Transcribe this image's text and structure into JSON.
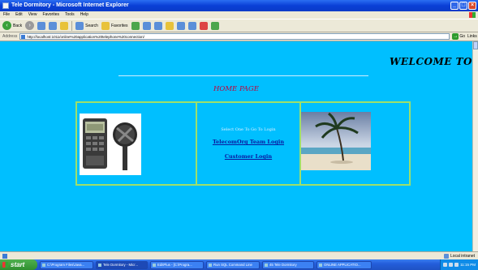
{
  "window": {
    "title": "Tele Dormitory - Microsoft Internet Explorer",
    "buttons": {
      "minimize": "_",
      "maximize": "□",
      "close": "×"
    }
  },
  "menu": [
    "File",
    "Edit",
    "View",
    "Favorites",
    "Tools",
    "Help"
  ],
  "toolbar": {
    "back_label": "Back",
    "search_label": "Search",
    "favorites_label": "Favorites"
  },
  "address": {
    "label": "Address",
    "url": "http://localhost:1011/online%20application%20telephone%20connection/",
    "go_label": "Go",
    "links_label": "Links"
  },
  "page": {
    "welcome": "WELCOME TO",
    "title": "HOME PAGE",
    "prompt": "Select One To Go To Login",
    "links": {
      "telecom": "TelecomOrg  Team Login",
      "customer": "Customer Login"
    }
  },
  "statusbar": {
    "zone": "Local intranet"
  },
  "taskbar": {
    "start": "start",
    "tasks": [
      "C:\\Program Files\\Java...",
      "Tele Dormitory - Micr...",
      "EditPlus - [C:\\Progra...",
      "Run SQL Command Line",
      "45 Tele Dormitory",
      "ONLINE APPLICATIO..."
    ],
    "clock": "11:15 PM"
  },
  "colors": {
    "page_bg": "#00bfff",
    "frame_border": "#9fe06a",
    "title_color": "#c0003a",
    "link_color": "#0a1aa0"
  }
}
